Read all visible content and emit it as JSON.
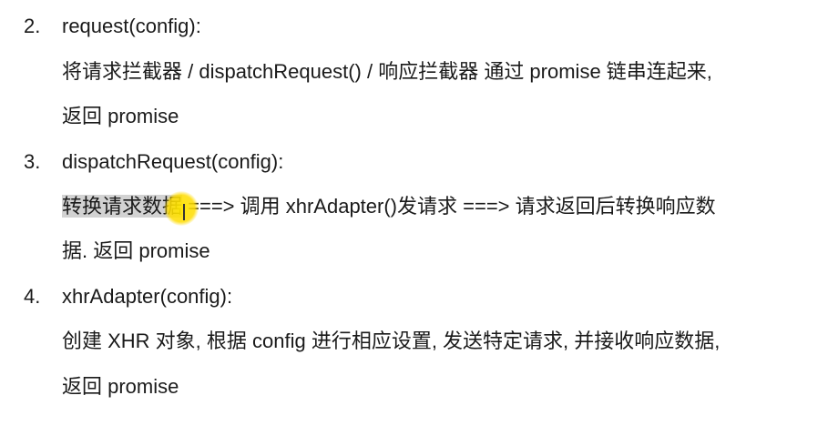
{
  "items": [
    {
      "number": "2.",
      "heading": "request(config):",
      "lines": [
        "将请求拦截器  / dispatchRequest() /  响应拦截器  通过 promise 链串连起来,",
        "返回 promise"
      ]
    },
    {
      "number": "3.",
      "heading": "dispatchRequest(config):",
      "highlight": "转换请求数据",
      "lines": [
        " ===>  调用 xhrAdapter()发请求  ===>  请求返回后转换响应数",
        "据. 返回 promise"
      ]
    },
    {
      "number": "4.",
      "heading": "xhrAdapter(config):",
      "lines": [
        "创建 XHR 对象, 根据 config 进行相应设置, 发送特定请求, 并接收响应数据,",
        "返回 promise"
      ]
    }
  ]
}
